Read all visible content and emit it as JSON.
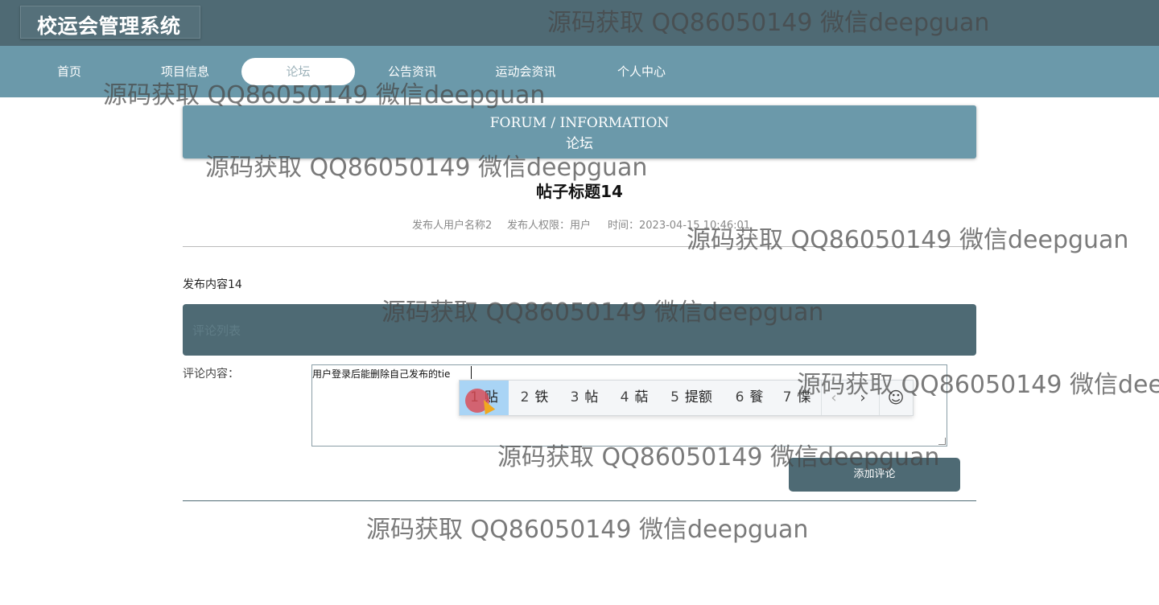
{
  "app": {
    "title": "校运会管理系统"
  },
  "nav": {
    "items": [
      {
        "label": "首页"
      },
      {
        "label": "项目信息"
      },
      {
        "label": "论坛"
      },
      {
        "label": "公告资讯"
      },
      {
        "label": "运动会资讯"
      },
      {
        "label": "个人中心"
      }
    ],
    "active_index": 2
  },
  "banner": {
    "en": "FORUM / INFORMATION",
    "cn": "论坛"
  },
  "post": {
    "title": "帖子标题14",
    "author": "发布人用户名称2",
    "role": "发布人权限：用户",
    "time": "时间：2023-04-15 10:46:01",
    "content": "发布内容14"
  },
  "comments": {
    "header": "评论列表"
  },
  "comment_form": {
    "label": "评论内容：",
    "value": "用户登录后能删除自己发布的tie",
    "submit_label": "添加评论"
  },
  "ime": {
    "candidates": [
      {
        "num": "1",
        "text": "贴"
      },
      {
        "num": "2",
        "text": "铁"
      },
      {
        "num": "3",
        "text": "帖"
      },
      {
        "num": "4",
        "text": "萜"
      },
      {
        "num": "5",
        "text": "提额"
      },
      {
        "num": "6",
        "text": "餮"
      },
      {
        "num": "7",
        "text": "惵"
      }
    ],
    "prev": "‹",
    "next": "›",
    "emoji": "☺"
  },
  "watermark": {
    "text": "源码获取 QQ86050149 微信deepguan"
  },
  "colors": {
    "topbar": "#4f6a74",
    "nav": "#6b99aa",
    "accent_dark": "#4e6a74"
  }
}
